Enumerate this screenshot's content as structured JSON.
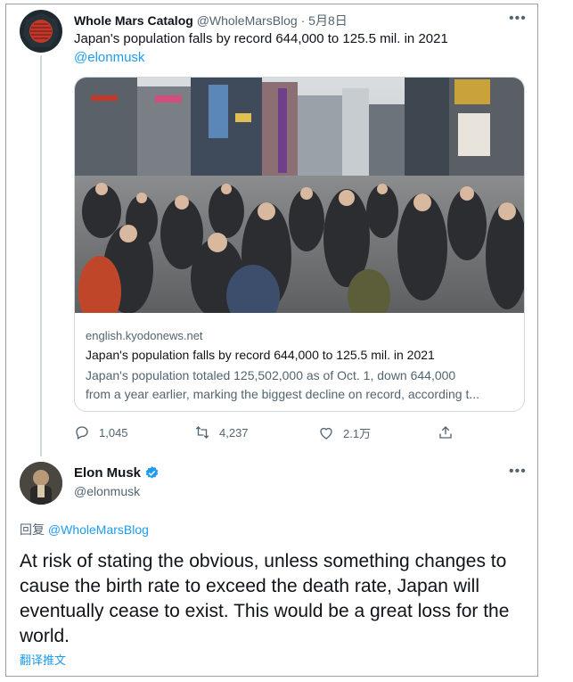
{
  "tweet1": {
    "display_name": "Whole Mars Catalog",
    "handle": "@WholeMarsBlog",
    "separator": "·",
    "date": "5月8日",
    "more": "•••",
    "text": "Japan's population falls by record 644,000 to 125.5 mil. in 2021",
    "mention": "@elonmusk",
    "card": {
      "domain": "english.kyodonews.net",
      "title": "Japan's population falls by record 644,000 to 125.5 mil. in 2021",
      "desc_line1": "Japan's population totaled 125,502,000 as of Oct. 1, down 644,000",
      "desc_line2": "from a year earlier, marking the biggest decline on record, according t..."
    },
    "actions": {
      "replies": "1,045",
      "retweets": "4,237",
      "likes": "2.1万"
    }
  },
  "tweet2": {
    "display_name": "Elon Musk",
    "handle": "@elonmusk",
    "more": "•••",
    "reply_prefix": "回复",
    "reply_to": "@WholeMarsBlog",
    "text": "At risk of stating the obvious, unless something changes to cause the birth rate to exceed the death rate, Japan will eventually cease to exist. This would be a great loss for the world.",
    "translate": "翻译推文"
  },
  "colors": {
    "text": "#0f1419",
    "muted": "#536471",
    "link": "#1d9bf0",
    "border": "#cfd9de",
    "verified": "#1d9bf0"
  },
  "icons": [
    "reply-icon",
    "retweet-icon",
    "like-icon",
    "share-icon",
    "verified-badge-icon",
    "more-icon"
  ]
}
